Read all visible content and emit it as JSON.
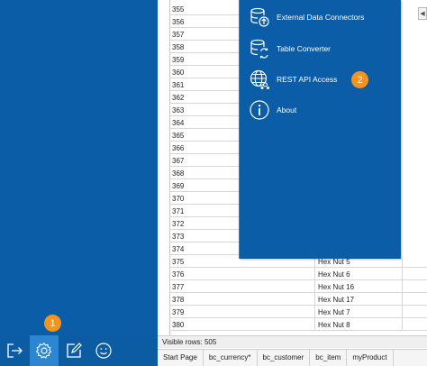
{
  "menu": {
    "items": [
      {
        "label": "External Data Connectors",
        "icon": "database-upload-icon"
      },
      {
        "label": "Table Converter",
        "icon": "database-convert-icon"
      },
      {
        "label": "REST API Access",
        "icon": "globe-network-icon"
      },
      {
        "label": "About",
        "icon": "info-icon"
      }
    ],
    "badge_rest_api": "2"
  },
  "bottom_bar": {
    "icons": [
      "exit-icon",
      "gear-icon",
      "edit-icon",
      "smiley-icon"
    ],
    "badge_settings": "1"
  },
  "grid": {
    "rows": [
      {
        "num": "355",
        "item": ""
      },
      {
        "num": "356",
        "item": ""
      },
      {
        "num": "357",
        "item": ""
      },
      {
        "num": "358",
        "item": ""
      },
      {
        "num": "359",
        "item": ""
      },
      {
        "num": "360",
        "item": ""
      },
      {
        "num": "361",
        "item": ""
      },
      {
        "num": "362",
        "item": ""
      },
      {
        "num": "363",
        "item": ""
      },
      {
        "num": "364",
        "item": ""
      },
      {
        "num": "365",
        "item": ""
      },
      {
        "num": "366",
        "item": ""
      },
      {
        "num": "367",
        "item": ""
      },
      {
        "num": "368",
        "item": ""
      },
      {
        "num": "369",
        "item": ""
      },
      {
        "num": "370",
        "item": ""
      },
      {
        "num": "371",
        "item": ""
      },
      {
        "num": "372",
        "item": ""
      },
      {
        "num": "373",
        "item": ""
      },
      {
        "num": "374",
        "item": ""
      },
      {
        "num": "375",
        "item": "Hex Nut 5"
      },
      {
        "num": "376",
        "item": "Hex Nut 6"
      },
      {
        "num": "377",
        "item": "Hex Nut 16"
      },
      {
        "num": "378",
        "item": "Hex Nut 17"
      },
      {
        "num": "379",
        "item": "Hex Nut 7"
      },
      {
        "num": "380",
        "item": "Hex Nut 8"
      }
    ]
  },
  "status": {
    "visible_rows": "Visible rows: 505"
  },
  "tabs": [
    "Start Page",
    "bc_currency*",
    "bc_customer",
    "bc_item",
    "myProduct"
  ],
  "colors": {
    "panel_blue": "#0a5da6",
    "badge_orange": "#f39320",
    "active_button": "#2d86d1"
  }
}
